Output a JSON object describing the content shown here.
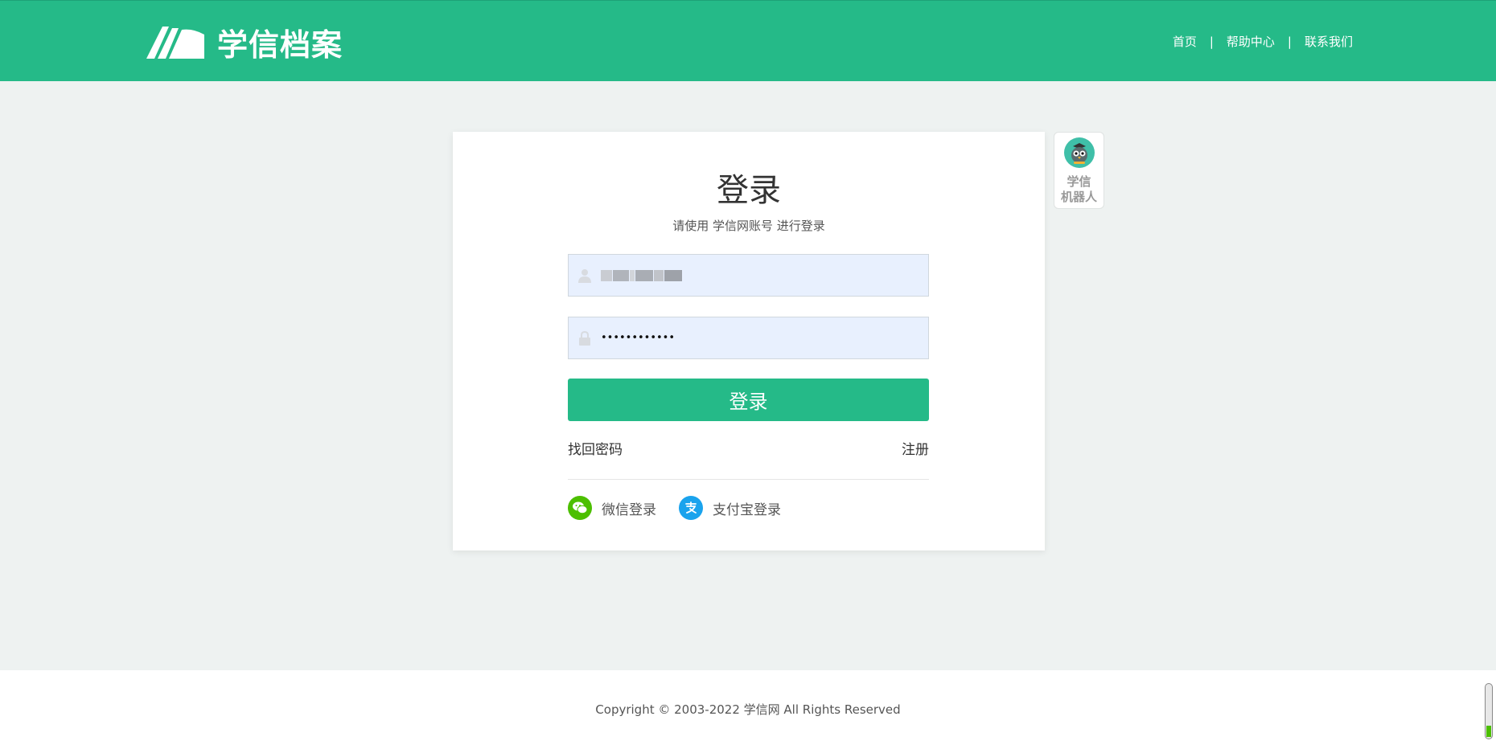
{
  "header": {
    "logo_text": "学信档案",
    "nav": [
      {
        "label": "首页"
      },
      {
        "label": "帮助中心"
      },
      {
        "label": "联系我们"
      }
    ],
    "nav_separator": "|"
  },
  "login": {
    "title": "登录",
    "subtitle": "请使用 学信网账号 进行登录",
    "username_value": "",
    "password_value": "••••••••••••",
    "submit_label": "登录",
    "forgot_password": "找回密码",
    "register": "注册",
    "wechat_login": "微信登录",
    "alipay_login": "支付宝登录"
  },
  "robot": {
    "label_line1": "学信",
    "label_line2": "机器人"
  },
  "footer": {
    "copyright": "Copyright © 2003-2022 学信网 All Rights Reserved"
  },
  "colors": {
    "brand": "#25ba88",
    "wechat": "#4cbf00",
    "alipay": "#1aa3ed"
  }
}
